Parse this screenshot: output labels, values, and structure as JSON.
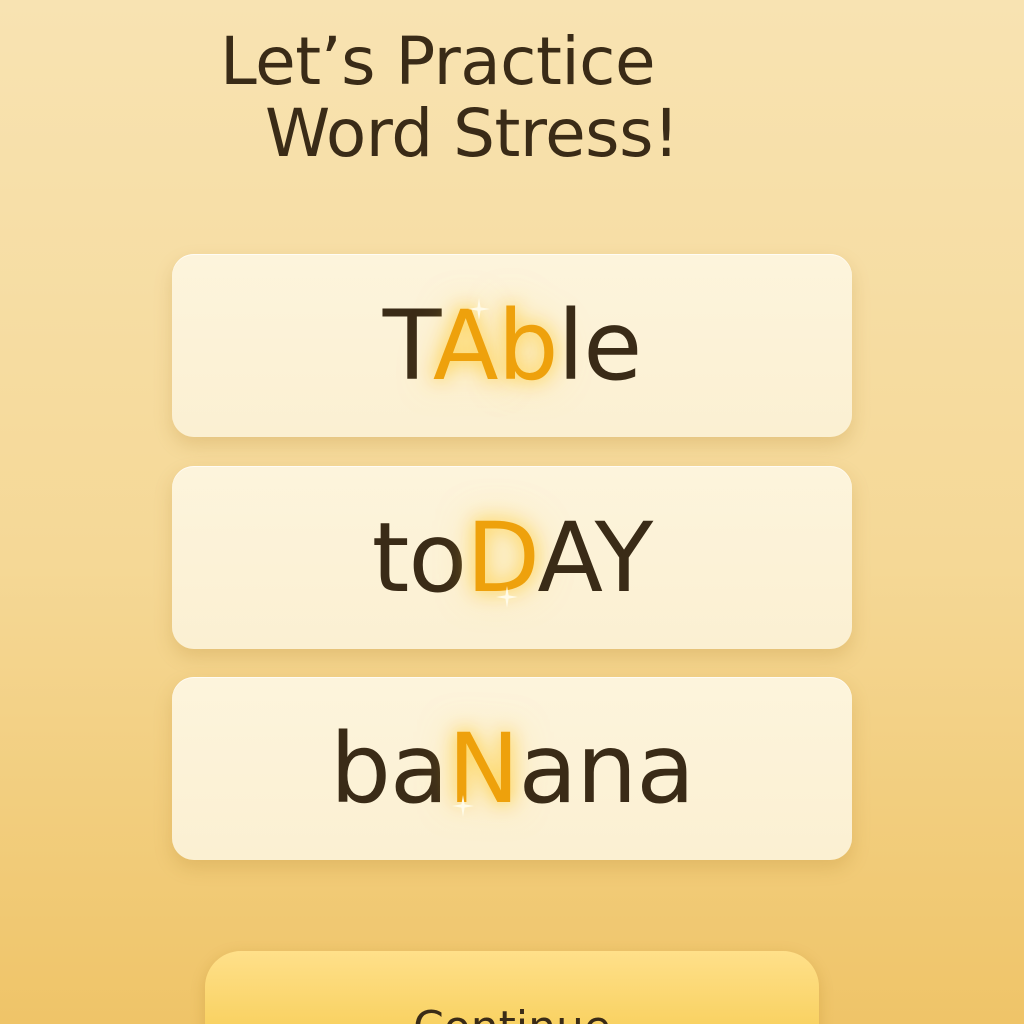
{
  "title": {
    "line1": "Let’s Practice",
    "line2": "Word Stress!"
  },
  "words": [
    {
      "pre": "T",
      "stress": "Ab",
      "post": "le"
    },
    {
      "pre": "to",
      "stress": "D",
      "post": "AY"
    },
    {
      "pre": "ba",
      "stress": "N",
      "post": "ana"
    }
  ],
  "continue_label": "Continue",
  "colors": {
    "background": "#f6dc9f",
    "card": "#fcf2d7",
    "text": "#3a2b17",
    "stress": "#eea10c",
    "button": "#f7cf5a"
  },
  "icons": [
    "sparkle-icon"
  ]
}
